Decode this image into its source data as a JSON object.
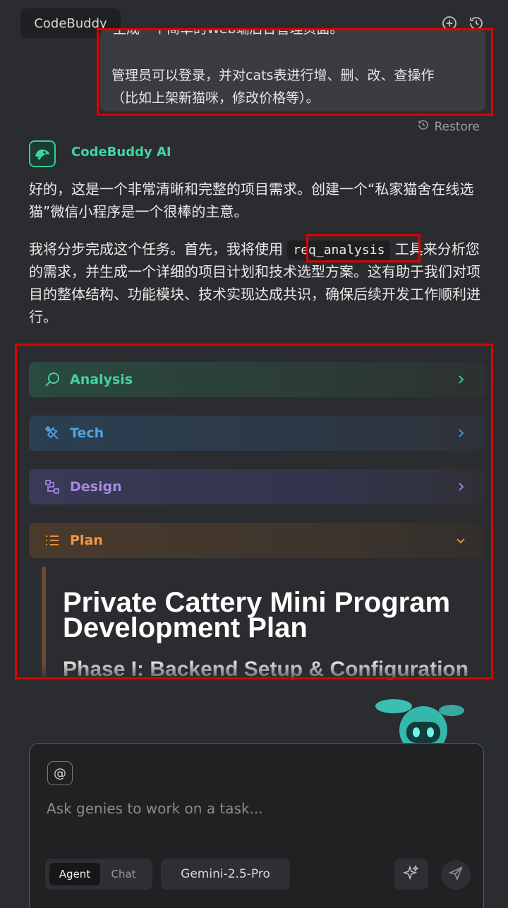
{
  "header": {
    "app_tab": "CodeBuddy",
    "new_chat_icon": "plus-circle-icon",
    "history_icon": "history-icon"
  },
  "user_message": {
    "cut_line": "生成一个简单的Web端后台管理页面。",
    "line2": "管理员可以登录，并对cats表进行增、删、改、查操作",
    "line3": "（比如上架新猫咪，修改价格等）。"
  },
  "restore": {
    "label": "Restore",
    "icon": "restore-icon"
  },
  "assistant": {
    "name": "CodeBuddy AI",
    "avatar_icon": "codebuddy-logo-icon",
    "para1": "好的，这是一个非常清晰和完整的项目需求。创建一个“私家猫舍在线选猫”微信小程序是一个很棒的主意。",
    "para2_before": "我将分步完成这个任务。首先，我将使用 ",
    "para2_code": "req_analysis",
    "para2_after": " 工具来分析您的需求，并生成一个详细的项目计划和技术选型方案。这有助于我们对项目的整体结构、功能模块、技术实现达成共识，确保后续开发工作顺利进行。"
  },
  "accordions": [
    {
      "label": "Analysis",
      "icon": "search-icon",
      "expanded": false,
      "color": "#42d39f"
    },
    {
      "label": "Tech",
      "icon": "tools-icon",
      "expanded": false,
      "color": "#4ea3e4"
    },
    {
      "label": "Design",
      "icon": "design-flow-icon",
      "expanded": false,
      "color": "#a48ae2"
    },
    {
      "label": "Plan",
      "icon": "list-icon",
      "expanded": true,
      "color": "#f09a48"
    }
  ],
  "plan": {
    "title": "Private Cattery Mini Program Development Plan",
    "phase1": "Phase I: Backend Setup & Configuration (Supabase)"
  },
  "composer": {
    "at_label": "@",
    "placeholder": "Ask genies to work on a task...",
    "mode_agent": "Agent",
    "mode_chat": "Chat",
    "selected_mode": "Agent",
    "model": "Gemini-2.5-Pro",
    "enhance_icon": "sparkle-icon",
    "send_icon": "send-icon"
  }
}
